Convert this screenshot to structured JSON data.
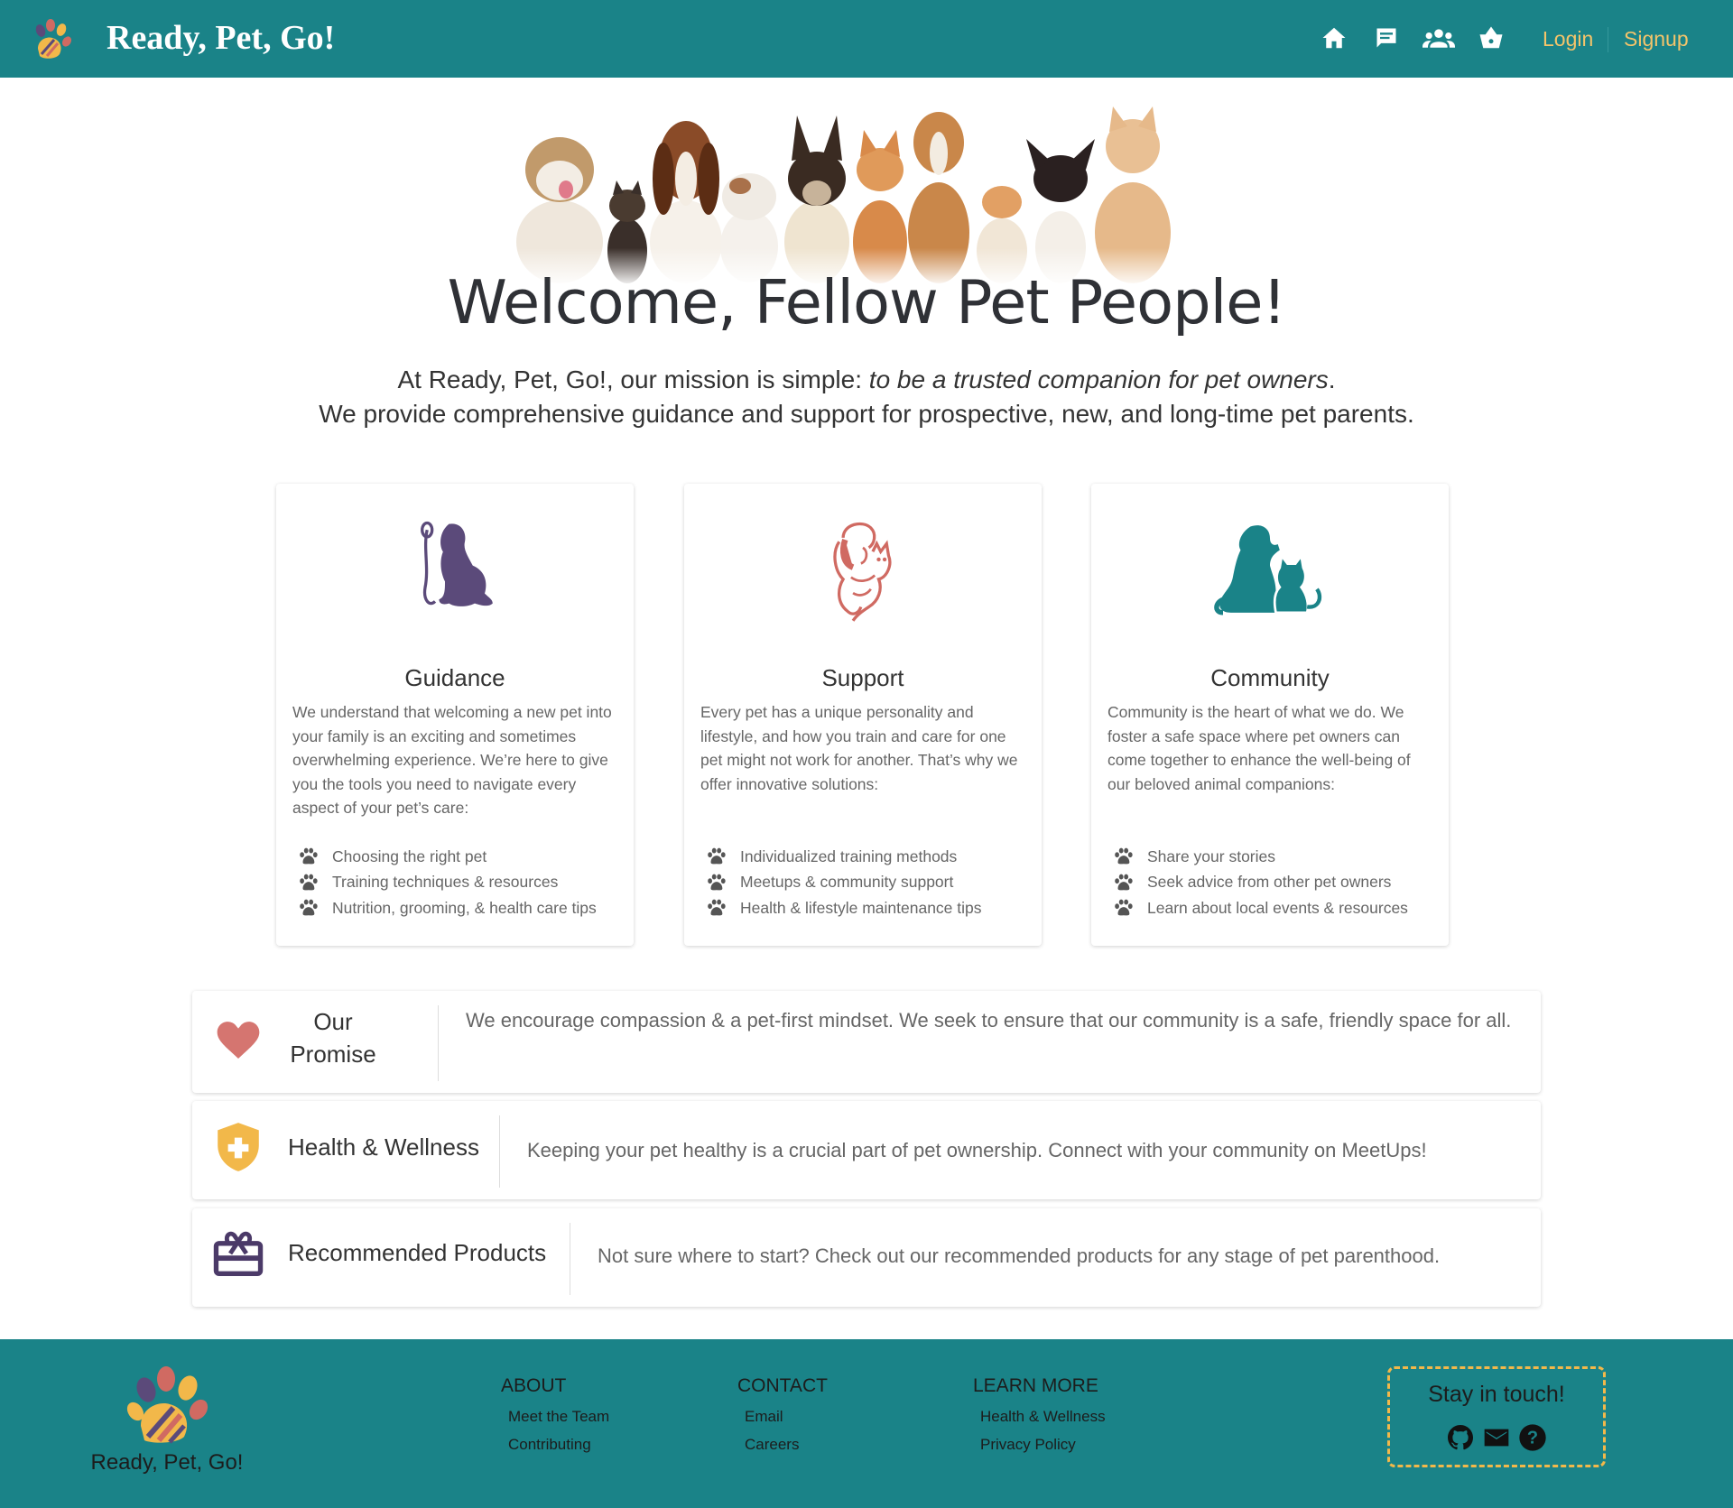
{
  "nav": {
    "brand": "Ready, Pet, Go!",
    "icons": [
      "home-icon",
      "chat-icon",
      "people-icon",
      "basket-icon"
    ],
    "login": "Login",
    "signup": "Signup"
  },
  "hero": {
    "title": "Welcome, Fellow Pet People!",
    "mission_prefix": "At Ready, Pet, Go!, our mission is simple: ",
    "mission_emphasis": "to be a trusted companion for pet owners",
    "mission_suffix": ".",
    "mission_line2": "We provide comprehensive guidance and support for prospective, new, and long-time pet parents."
  },
  "cards": [
    {
      "title": "Guidance",
      "icon": "dog-leash-icon",
      "color": "#5b4a7a",
      "description": "We understand that welcoming a new pet into your family is an exciting and sometimes overwhelming experience. We’re here to give you the tools you need to navigate every aspect of your pet’s care:",
      "items": [
        "Choosing the right pet",
        "Training techniques & resources",
        "Nutrition, grooming, & health care tips"
      ]
    },
    {
      "title": "Support",
      "icon": "person-hugging-cat-icon",
      "color": "#d06a62",
      "description": "Every pet has a unique personality and lifestyle, and how you train and care for one pet might not work for another. That’s why we offer innovative solutions:",
      "items": [
        "Individualized training methods",
        "Meetups & community support",
        "Health & lifestyle maintenance tips"
      ]
    },
    {
      "title": "Community",
      "icon": "dog-and-cat-icon",
      "color": "#1a8388",
      "description": "Community is the heart of what we do. We foster a safe space where pet owners can come together to enhance the well-being of our beloved animal companions:",
      "items": [
        "Share your stories",
        "Seek advice from other pet owners",
        "Learn about local events & resources"
      ]
    }
  ],
  "features": [
    {
      "title_line1": "Our",
      "title_line2": "Promise",
      "icon": "heart-icon",
      "color": "#d57570",
      "text": "We encourage compassion & a pet-first mindset. We seek to ensure that our community is a safe, friendly space for all."
    },
    {
      "title": "Health & Wellness",
      "icon": "shield-plus-icon",
      "color": "#f2b84a",
      "text": "Keeping your pet healthy is a crucial part of pet ownership. Connect with your community on MeetUps!"
    },
    {
      "title": "Recommended Products",
      "icon": "gift-card-icon",
      "color": "#4b3a68",
      "text": "Not sure where to start? Check out our recommended products for any stage of pet parenthood."
    }
  ],
  "footer": {
    "brand": "Ready, Pet, Go!",
    "about": {
      "heading": "ABOUT",
      "links": [
        "Meet the Team",
        "Contributing"
      ]
    },
    "contact": {
      "heading": "CONTACT",
      "links": [
        "Email",
        "Careers"
      ]
    },
    "learn": {
      "heading": "LEARN MORE",
      "links": [
        "Health & Wellness",
        "Privacy Policy"
      ]
    },
    "stay_title": "Stay in touch!",
    "stay_icons": [
      "github-icon",
      "mail-icon",
      "help-icon"
    ]
  },
  "colors": {
    "teal": "#1a8388",
    "gold": "#f4c46a",
    "purple": "#5b4a7a",
    "coral": "#d06a62"
  }
}
